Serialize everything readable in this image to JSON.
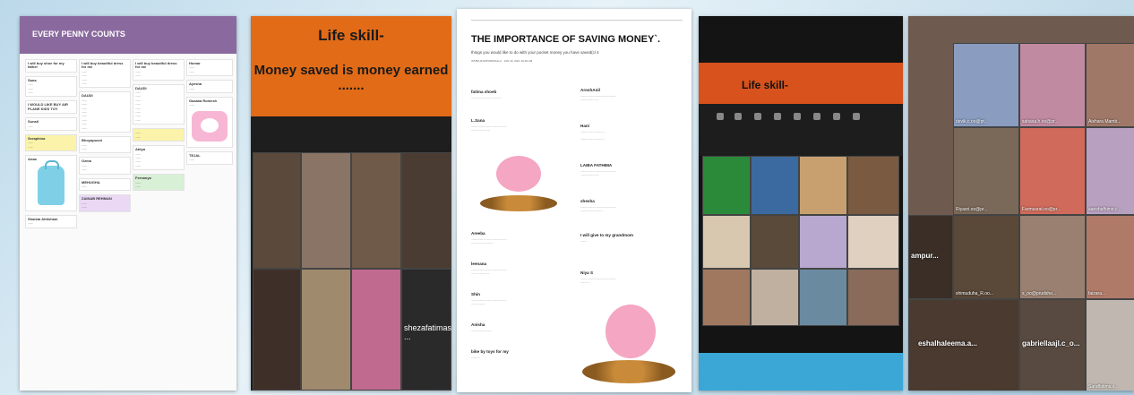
{
  "panel1": {
    "title": "EVERY PENNY COUNTS",
    "header_small": "...",
    "cards": {
      "c1a": "I will buy shoe for my father",
      "c1b": "Sana",
      "c1c": "I WOULD LIKE BUY AIR PLANE KIDS TOY",
      "c1d": "Sunail",
      "c1e": "Seraphina",
      "c1f": "Anaa",
      "c1g": "Shaista Ahtisham",
      "c2a": "I will buy beautiful dress for me",
      "c2b": "DAUDI",
      "c2c": "Bhoyapooni",
      "c2d": "Ozma",
      "c2e": "MEHUGHA",
      "c2f": "ZAINAB REHMAN",
      "c3a": "I will buy beautiful dress for me",
      "c3b": "DAUDI",
      "c3c": "Attiya",
      "c3d": "Fernanya",
      "c4a": "Humar",
      "c4b": "Ayesha",
      "c4c": "Gazaba Romesh",
      "c4d": "TEJAL"
    }
  },
  "panel2": {
    "banner_line1": "Life skill-",
    "banner_line2": "Money saved is money earned .......",
    "name_tag": "shezafatimas ..."
  },
  "panel3": {
    "title": "THE IMPORTANCE OF SAVING MONEY`.",
    "subtitle": "things you would like to do with your pocket money you have saved(cl 4",
    "byline": "ISTIBA RAMPURIWALLA · JAN 19, 2021 10:29 AM",
    "entries": {
      "e1": "fatima shoeb",
      "e2": "L.Sana",
      "e3": "Areeba",
      "e4": "leenana",
      "e5": "Shin",
      "e6": "Anisha",
      "e7": "bike by toys for my",
      "e8": "AroshAnil",
      "e9": "Hani",
      "e10": "LAIBA FATHIMA",
      "e11": "shesha",
      "e12": "I will give to my grandmom",
      "e13": "Niya S"
    }
  },
  "panel4": {
    "banner": "Life skill-"
  },
  "panel5": {
    "labels": [
      "devik.c.oo@pr...",
      "sahasa.h.oo@pr...",
      "Aishara Mamb...",
      "Riyasri.oo@pr...",
      "Farmsarat.oo@pr...",
      "aanshafhime.c...",
      "shimuduha_R.oo...",
      "s_oo@prudshe...",
      "faizara...",
      "eshalhaleema.a...",
      "gabriellaajl.c_o...",
      "Saraffatima.s...",
      "ampur..."
    ]
  }
}
